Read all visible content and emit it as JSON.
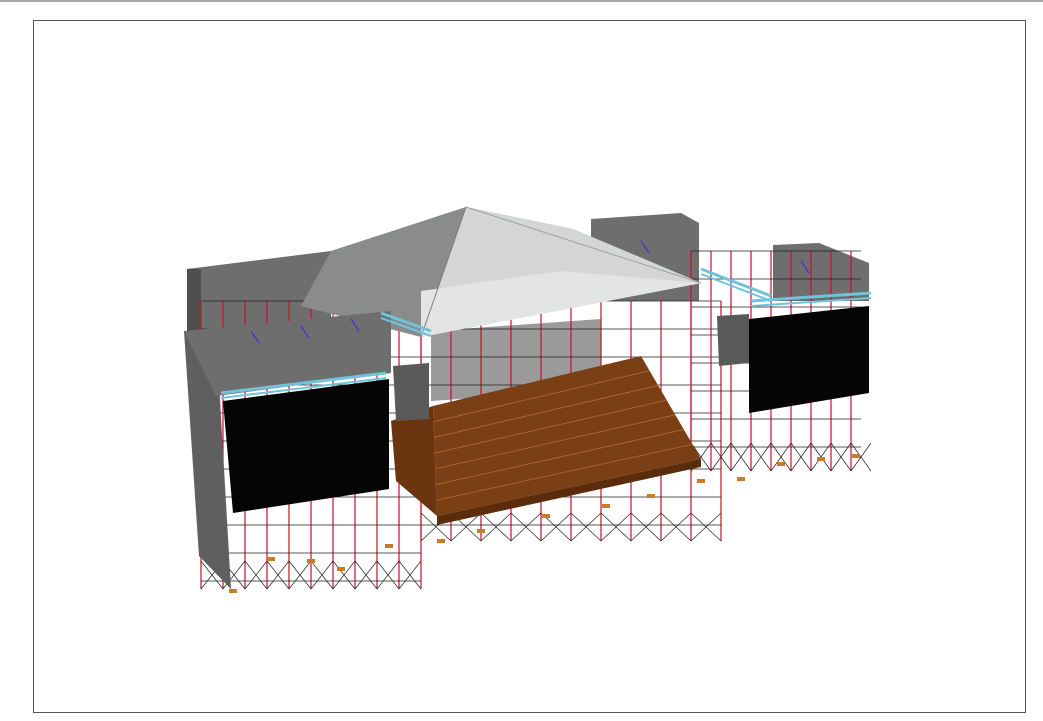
{
  "drawing": {
    "colors": {
      "roof_light": "#d4d6d6",
      "roof_mid": "#bcbebe",
      "roof_dark": "#8a8c8c",
      "wall": "#6e6e6e",
      "wall_dark": "#4e4e4e",
      "screen": "#050505",
      "deck": "#7a3f14",
      "deck_edge": "#5a2c0c",
      "truss": "#6fc4dc",
      "scaffold": "#222222",
      "vertical_post": "#c8102e",
      "brace_accent": "#4a2fd0",
      "baseplate": "#c97a2a"
    }
  }
}
